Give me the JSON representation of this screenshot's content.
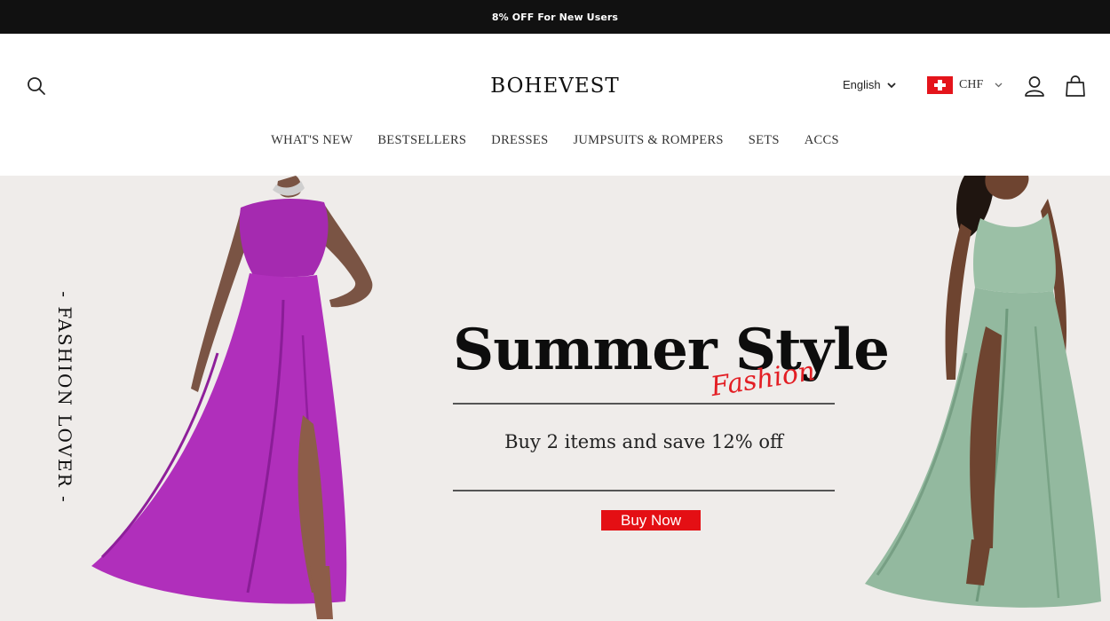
{
  "announcement": {
    "text": "8% OFF For New Users"
  },
  "header": {
    "logo": "BOHEVEST",
    "language": "English",
    "currency": "CHF",
    "icons": [
      "search-icon",
      "user-icon",
      "shopping-bag-icon",
      "chevron-down-icon",
      "swiss-flag-icon"
    ]
  },
  "nav": {
    "items": [
      {
        "label": "WHAT'S NEW"
      },
      {
        "label": "BESTSELLERS"
      },
      {
        "label": "DRESSES"
      },
      {
        "label": "JUMPSUITS & ROMPERS"
      },
      {
        "label": "SETS"
      },
      {
        "label": "ACCS"
      }
    ]
  },
  "hero": {
    "side_text": "- FASHION LOVER -",
    "headline": "Summer Style",
    "script": "Fashion",
    "subline": "Buy 2 items and save 12% off",
    "cta": "Buy Now"
  },
  "colors": {
    "topbar": "#111111",
    "accent": "#e40f14",
    "hero_bg": "#efecea",
    "purple_dress": "#a52ab0",
    "green_dress": "#93b99f"
  }
}
